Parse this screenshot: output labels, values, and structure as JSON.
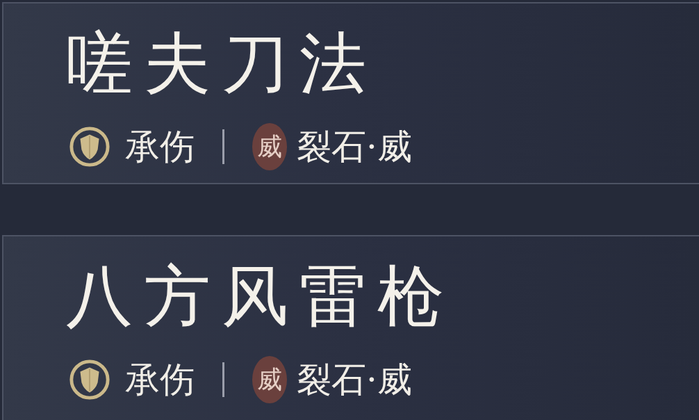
{
  "cards": [
    {
      "title": "嗟夫刀法",
      "tags": [
        {
          "kind": "role",
          "label": "承伤"
        },
        {
          "kind": "seal",
          "seal": "威",
          "label": "裂石·威"
        }
      ]
    },
    {
      "title": "八方风雷枪",
      "tags": [
        {
          "kind": "role",
          "label": "承伤"
        },
        {
          "kind": "seal",
          "seal": "威",
          "label": "裂石·威"
        }
      ]
    }
  ]
}
